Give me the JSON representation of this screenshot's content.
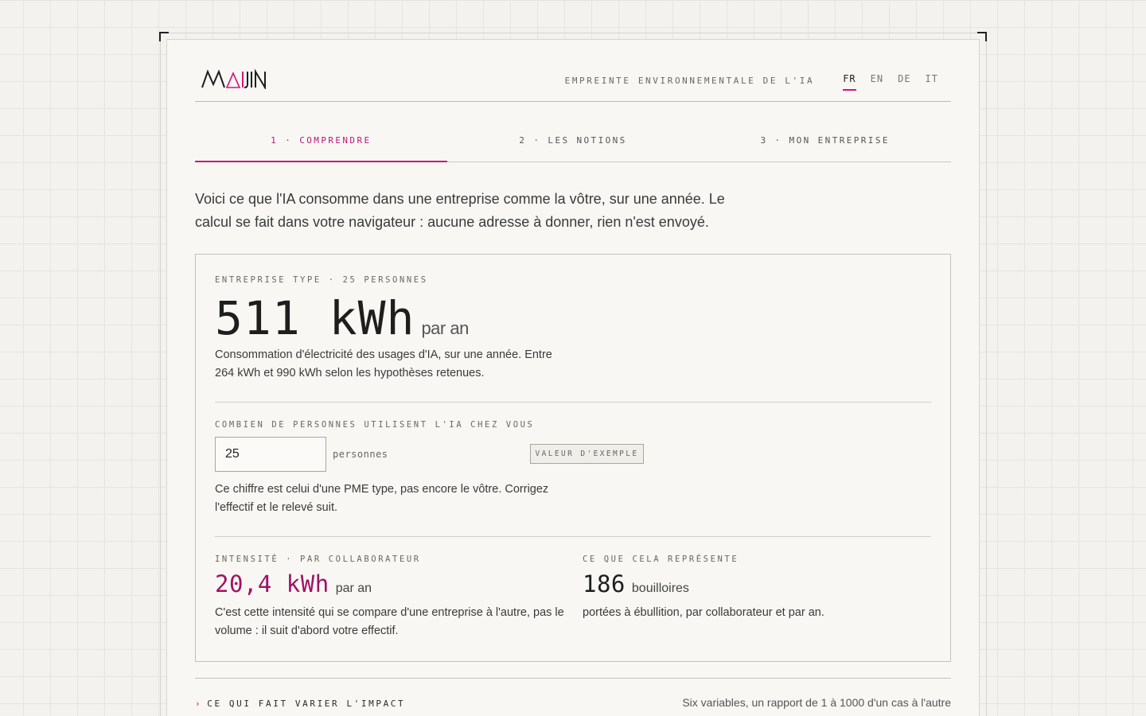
{
  "header": {
    "logo_text": "MAIJIN",
    "title": "EMPREINTE ENVIRONNEMENTALE DE L'IA",
    "languages": [
      {
        "code": "FR",
        "active": true
      },
      {
        "code": "EN",
        "active": false
      },
      {
        "code": "DE",
        "active": false
      },
      {
        "code": "IT",
        "active": false
      }
    ]
  },
  "tabs": [
    {
      "label": "1 · COMPRENDRE",
      "active": true
    },
    {
      "label": "2 · LES NOTIONS",
      "active": false
    },
    {
      "label": "3 · MON ENTREPRISE",
      "active": false
    }
  ],
  "intro": "Voici ce que l'IA consomme dans une entreprise comme la vôtre, sur une année. Le calcul se fait dans votre navigateur : aucune adresse à donner, rien n'est envoyé.",
  "panel": {
    "company_label": "ENTREPRISE TYPE · 25 PERSONNES",
    "total_value": "511 kWh",
    "total_unit": "par an",
    "total_desc": "Consommation d'électricité des usages d'IA, sur une année. Entre 264 kWh et 990 kWh selon les hypothèses retenues.",
    "people_label": "COMBIEN DE PERSONNES UTILISENT L'IA CHEZ VOUS",
    "people_value": "25",
    "people_unit": "personnes",
    "example_button": "VALEUR D'EXEMPLE",
    "people_desc": "Ce chiffre est celui d'une PME type, pas encore le vôtre. Corrigez l'effectif et le relevé suit.",
    "intensity_label": "INTENSITÉ · PAR COLLABORATEUR",
    "intensity_value": "20,4 kWh",
    "intensity_unit": "par an",
    "intensity_desc": "C'est cette intensité qui se compare d'une entreprise à l'autre, pas le volume : il suit d'abord votre effectif.",
    "represents_label": "CE QUE CELA REPRÉSENTE",
    "represents_value": "186",
    "represents_unit": "bouilloires",
    "represents_desc": "portées à ébullition, par collaborateur et par an."
  },
  "footer": {
    "chevron": "›",
    "left": "CE QUI FAIT VARIER L'IMPACT",
    "right": "Six variables, un rapport de 1 à 1000 d'un cas à l'autre"
  },
  "colors": {
    "accent": "#d1167e",
    "accent_text": "#c0157a",
    "intensity": "#a01266"
  }
}
